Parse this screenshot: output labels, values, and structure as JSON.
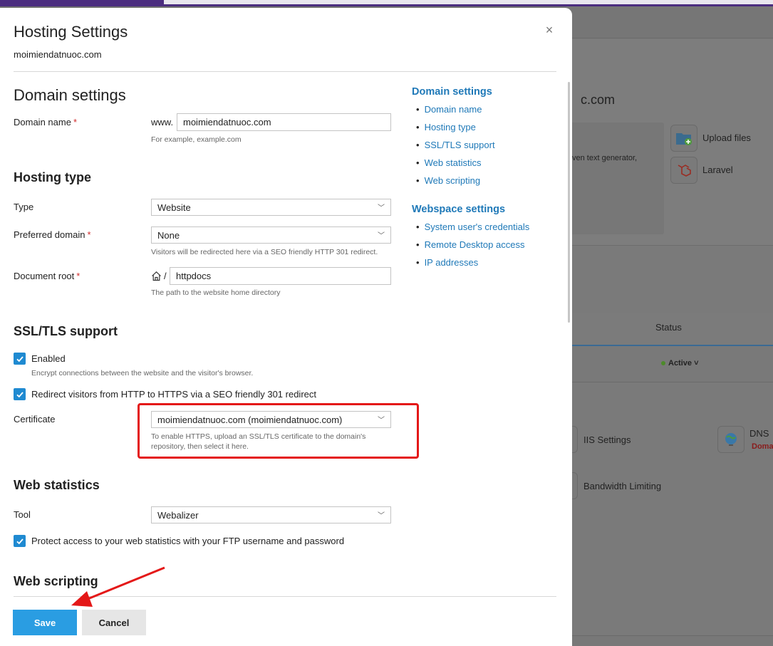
{
  "background": {
    "title": "c.com",
    "description": "ven text generator,",
    "links": [
      "Upload files",
      "Laravel"
    ],
    "table_header": "Status",
    "status": "Active",
    "tools": [
      "IIS Settings",
      "DNS",
      "Bandwidth Limiting"
    ],
    "dns_sub": "Doma"
  },
  "modal": {
    "title": "Hosting Settings",
    "subtitle": "moimiendatnuoc.com",
    "close_icon": "close-icon"
  },
  "domain_settings": {
    "heading": "Domain settings",
    "domain_name_label": "Domain name",
    "www_prefix": "www.",
    "domain_value": "moimiendatnuoc.com",
    "domain_hint": "For example, example.com"
  },
  "hosting_type": {
    "heading": "Hosting type",
    "type_label": "Type",
    "type_value": "Website",
    "preferred_label": "Preferred domain",
    "preferred_value": "None",
    "preferred_hint": "Visitors will be redirected here via a SEO friendly HTTP 301 redirect.",
    "docroot_label": "Document root",
    "docroot_sep": "/",
    "docroot_value": "httpdocs",
    "docroot_hint": "The path to the website home directory"
  },
  "ssl": {
    "heading": "SSL/TLS support",
    "enabled_label": "Enabled",
    "enabled_checked": true,
    "enabled_hint": "Encrypt connections between the website and the visitor's browser.",
    "redirect_label": "Redirect visitors from HTTP to HTTPS via a SEO friendly 301 redirect",
    "redirect_checked": true,
    "certificate_label": "Certificate",
    "certificate_value": "moimiendatnuoc.com (moimiendatnuoc.com)",
    "certificate_hint_1": "To enable HTTPS, upload an SSL/TLS certificate to the domain's",
    "certificate_hint_2": "repository, then select it here."
  },
  "web_statistics": {
    "heading": "Web statistics",
    "tool_label": "Tool",
    "tool_value": "Webalizer",
    "protect_label": "Protect access to your web statistics with your FTP username and password",
    "protect_checked": true
  },
  "web_scripting": {
    "heading": "Web scripting"
  },
  "toc": {
    "domain_heading": "Domain settings",
    "domain_items": [
      "Domain name",
      "Hosting type",
      "SSL/TLS support",
      "Web statistics",
      "Web scripting"
    ],
    "webspace_heading": "Webspace settings",
    "webspace_items": [
      "System user's credentials",
      "Remote Desktop access",
      "IP addresses"
    ]
  },
  "buttons": {
    "save": "Save",
    "cancel": "Cancel"
  },
  "colors": {
    "accent": "#1f79b8",
    "primary_button": "#2a9de2",
    "highlight": "#e41818",
    "checkbox": "#1f8ad1"
  }
}
